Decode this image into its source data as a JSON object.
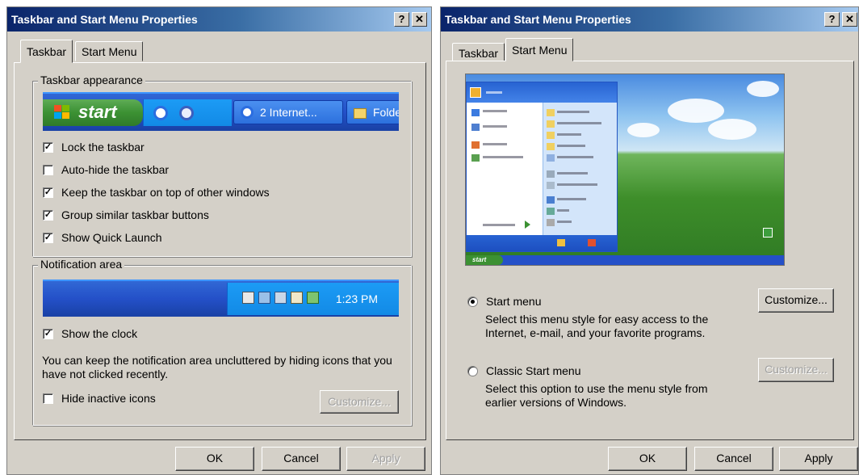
{
  "left_dialog": {
    "title": "Taskbar and Start Menu Properties",
    "help_btn": "?",
    "close_btn": "✕",
    "tabs": [
      "Taskbar",
      "Start Menu"
    ],
    "active_tab": "Taskbar",
    "taskbar_group": {
      "legend": "Taskbar appearance",
      "preview": {
        "start_label": "start",
        "task1_label": "2 Internet...",
        "task2_label": "Folde"
      },
      "options": [
        {
          "label": "Lock the taskbar",
          "checked": true
        },
        {
          "label": "Auto-hide the taskbar",
          "checked": false
        },
        {
          "label": "Keep the taskbar on top of other windows",
          "checked": true
        },
        {
          "label": "Group similar taskbar buttons",
          "checked": true
        },
        {
          "label": "Show Quick Launch",
          "checked": true
        }
      ]
    },
    "notification_group": {
      "legend": "Notification area",
      "clock_text": "1:23 PM",
      "show_clock": {
        "label": "Show the clock",
        "checked": true
      },
      "description": "You can keep the notification area uncluttered by hiding icons that you have not clicked recently.",
      "hide_inactive": {
        "label": "Hide inactive icons",
        "checked": false
      },
      "customize_label": "Customize...",
      "customize_enabled": false
    },
    "buttons": {
      "ok": "OK",
      "cancel": "Cancel",
      "apply": "Apply",
      "apply_enabled": false
    }
  },
  "right_dialog": {
    "title": "Taskbar and Start Menu Properties",
    "help_btn": "?",
    "close_btn": "✕",
    "tabs": [
      "Taskbar",
      "Start Menu"
    ],
    "active_tab": "Start Menu",
    "preview": {
      "start_label": "start"
    },
    "options": [
      {
        "label": "Start menu",
        "selected": true,
        "description": "Select this menu style for easy access to the Internet, e-mail, and your favorite programs.",
        "customize_label": "Customize...",
        "customize_enabled": true
      },
      {
        "label": "Classic Start menu",
        "selected": false,
        "description": "Select this option to use the menu style from earlier versions of Windows.",
        "customize_label": "Customize...",
        "customize_enabled": false
      }
    ],
    "buttons": {
      "ok": "OK",
      "cancel": "Cancel",
      "apply": "Apply",
      "apply_enabled": true
    }
  },
  "colors": {
    "dialog_bg": "#d4d0c8",
    "title_start": "#0a246a",
    "title_end": "#a6caf0",
    "xp_blue": "#2450c8",
    "xp_green": "#3c9133"
  }
}
